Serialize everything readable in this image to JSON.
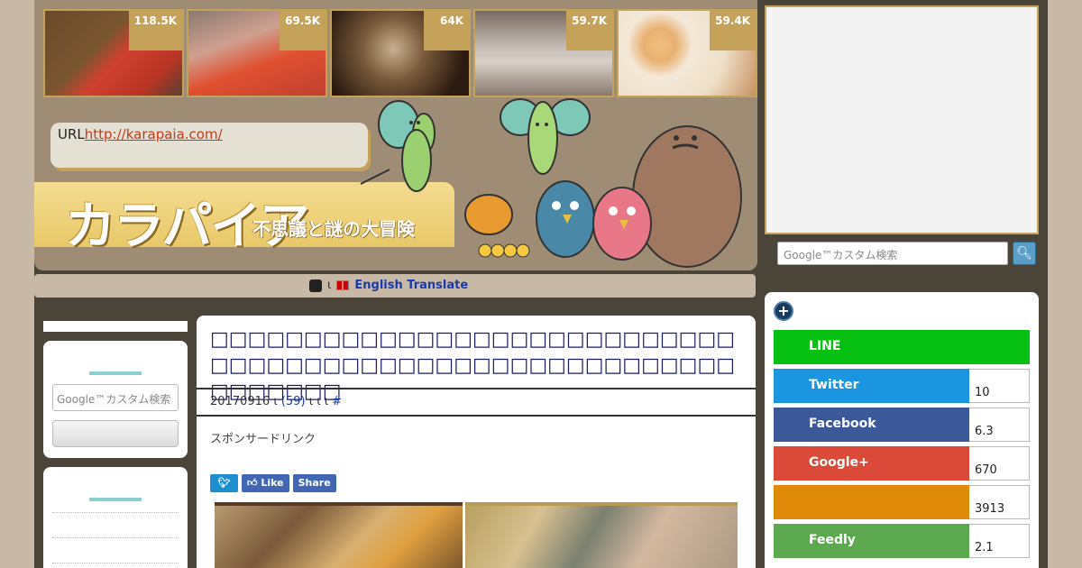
{
  "popular": [
    {
      "count": "118.5K"
    },
    {
      "count": "69.5K"
    },
    {
      "count": "64K"
    },
    {
      "count": "59.7K"
    },
    {
      "count": "59.4K"
    }
  ],
  "header": {
    "url_label": "URL",
    "url": "http://karapaia.com/",
    "logo": "カラパイア",
    "tagline": "不思議と謎の大冒険"
  },
  "translate": {
    "sep": "ι",
    "link": "English Translate"
  },
  "search": {
    "placeholder": "Google™カスタム検索",
    "icon": "search-icon"
  },
  "left_sidebar": {
    "search_placeholder": "Google™カスタム検索"
  },
  "article": {
    "title": "□□□□□□□□□□□□□□□□□□□□□□□□□□□□□□□□□□□□□□□□□□□□□□□□□□□□□□□□□□□□□□□",
    "date": "20170916",
    "sep1": "ι",
    "comments": "(59)",
    "sep2": "ι ι ι",
    "hash": "#",
    "sponsor": "スポンサードリンク",
    "share_like": "Like",
    "share_share": "Share"
  },
  "sns": [
    {
      "name": "LINE",
      "count": "",
      "color": "#06c012"
    },
    {
      "name": "Twitter",
      "count": "10",
      "color": "#1b95e0"
    },
    {
      "name": "Facebook",
      "count": "6.3",
      "color": "#3b5998"
    },
    {
      "name": "Google+",
      "count": "670",
      "color": "#db4a39"
    },
    {
      "name": "",
      "count": "3913",
      "color": "#e08a0a"
    },
    {
      "name": "Feedly",
      "count": "2.1",
      "color": "#5ca84f"
    }
  ],
  "colors": {
    "accent_gold": "#c4a25a",
    "link_red": "#c03a1a",
    "title_navy": "#1a1a6a"
  }
}
